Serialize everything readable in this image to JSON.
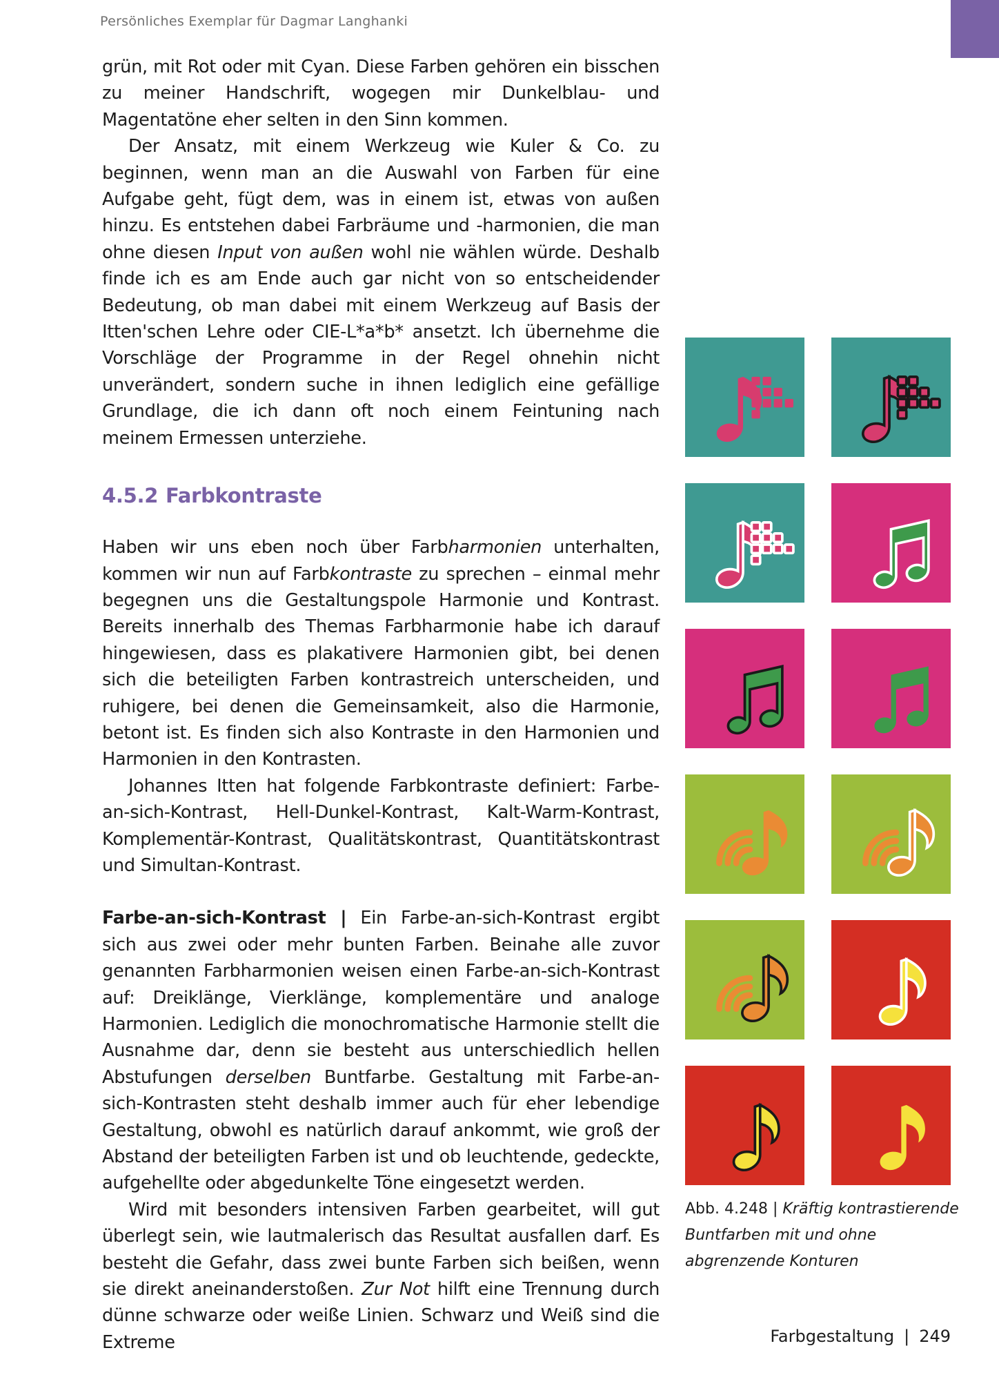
{
  "header": {
    "text": "Persönliches Exemplar für Dagmar Langhanki"
  },
  "body": {
    "p1": "grün, mit Rot oder mit Cyan. Diese Farben gehören ein bisschen zu meiner Handschrift, wogegen mir Dunkelblau- und Magentatöne eher selten in den Sinn kommen.",
    "p2a": "Der Ansatz, mit einem Werkzeug wie Kuler & Co. zu beginnen, wenn man an die Auswahl von Farben für eine Aufgabe geht, fügt dem, was in einem ist, etwas von außen hinzu. Es entstehen dabei Farbräume und -harmonien, die man ohne diesen ",
    "p2b": "Input von außen",
    "p2c": " wohl nie wählen würde. Deshalb finde ich es am Ende auch gar nicht von so entscheidender Bedeutung, ob man dabei mit einem Werkzeug auf Basis der Itten'schen Lehre oder CIE-L*a*b* ansetzt. Ich übernehme die Vorschläge der Programme in der Regel ohnehin nicht unverändert, sondern suche in ihnen lediglich eine gefällige Grundlage, die ich dann oft noch einem Feintuning nach meinem Ermessen unterziehe.",
    "heading_num": "4.5.2",
    "heading_title": "Farbkontraste",
    "p3a": "Haben wir uns eben noch über Farb",
    "p3b": "harmonien",
    "p3c": " unterhalten, kommen wir nun auf Farb",
    "p3d": "kontraste",
    "p3e": " zu sprechen – einmal mehr begegnen uns die Gestaltungspole Harmonie und Kontrast. Bereits innerhalb des Themas Farbharmonie habe ich darauf hingewiesen, dass es plakativere Harmonien gibt, bei denen sich die beteiligten Farben kontrastreich unterscheiden, und ruhigere, bei denen die Gemeinsamkeit, also die Harmonie, betont ist. Es finden sich also Kontraste in den Harmonien und Harmonien in den Kontrasten.",
    "p4": "Johannes Itten hat folgende Farbkontraste definiert: Farbe-an-sich-Kontrast, Hell-Dunkel-Kontrast, Kalt-Warm-Kontrast, Komplementär-Kontrast, Qualitätskontrast, Quantitätskontrast und Simultan-Kontrast.",
    "p5a": "Farbe-an-sich-Kontrast |",
    "p5b": " Ein Farbe-an-sich-Kontrast ergibt sich aus zwei oder mehr bunten Farben. Beinahe alle zuvor genannten Farbharmonien weisen einen Farbe-an-sich-Kontrast auf: Dreiklänge, Vierklänge, komplementäre und analoge Harmonien. Lediglich die monochromatische Harmonie stellt die Ausnahme dar, denn sie besteht aus unterschiedlich hellen Abstufungen ",
    "p5c": "derselben",
    "p5d": " Buntfarbe. Gestaltung mit Farbe-an-sich-Kontrasten steht deshalb immer auch für eher lebendige Gestaltung, obwohl es natürlich darauf ankommt, wie groß der Abstand der beteiligten Farben ist und ob leuchtende, gedeckte, aufgehellte oder abgedunkelte Töne eingesetzt werden.",
    "p6a": "Wird mit besonders intensiven Farben gearbeitet, will gut überlegt sein, wie lautmalerisch das Resultat ausfallen darf. Es besteht die Gefahr, dass zwei bunte Farben sich beißen, wenn sie direkt aneinanderstoßen. ",
    "p6b": "Zur Not",
    "p6c": " hilft eine Trennung durch dünne schwarze oder weiße Linien. Schwarz und Weiß sind die Extreme"
  },
  "figure": {
    "caption_label": "Abb. 4.248 |",
    "caption_text": "Kräftig kontrastierende Buntfarben mit und ohne abgrenzende Konturen",
    "tiles": [
      {
        "bg": "#3f9a92",
        "icon": "note-with-grid",
        "fill": "#d73c6e",
        "stroke": "none"
      },
      {
        "bg": "#3f9a92",
        "icon": "note-with-grid",
        "fill": "#d73c6e",
        "stroke": "#1a1a1a"
      },
      {
        "bg": "#3f9a92",
        "icon": "note-with-grid",
        "fill": "#d73c6e",
        "stroke": "#ffffff"
      },
      {
        "bg": "#d62f7c",
        "icon": "double-note",
        "fill": "#3e9a4b",
        "stroke": "#ffffff"
      },
      {
        "bg": "#d62f7c",
        "icon": "double-note",
        "fill": "#3e9a4b",
        "stroke": "#1a1a1a"
      },
      {
        "bg": "#d62f7c",
        "icon": "double-note",
        "fill": "#3e9a4b",
        "stroke": "none"
      },
      {
        "bg": "#9cbd3c",
        "icon": "note-with-waves",
        "fill": "#ea8b34",
        "stroke": "none"
      },
      {
        "bg": "#9cbd3c",
        "icon": "note-with-waves",
        "fill": "#ea8b34",
        "stroke": "#ffffff"
      },
      {
        "bg": "#9cbd3c",
        "icon": "note-with-waves",
        "fill": "#ea8b34",
        "stroke": "#1a1a1a"
      },
      {
        "bg": "#d42e23",
        "icon": "single-note",
        "fill": "#f5e13c",
        "stroke": "#ffffff"
      },
      {
        "bg": "#d42e23",
        "icon": "single-note",
        "fill": "#f5e13c",
        "stroke": "#1a1a1a"
      },
      {
        "bg": "#d42e23",
        "icon": "single-note",
        "fill": "#f5e13c",
        "stroke": "none"
      }
    ]
  },
  "footer": {
    "section": "Farbgestaltung",
    "separator": "|",
    "page": "249"
  },
  "colors": {
    "accent": "#7a62a6",
    "text": "#1c1c1c",
    "header_text": "#707070"
  }
}
